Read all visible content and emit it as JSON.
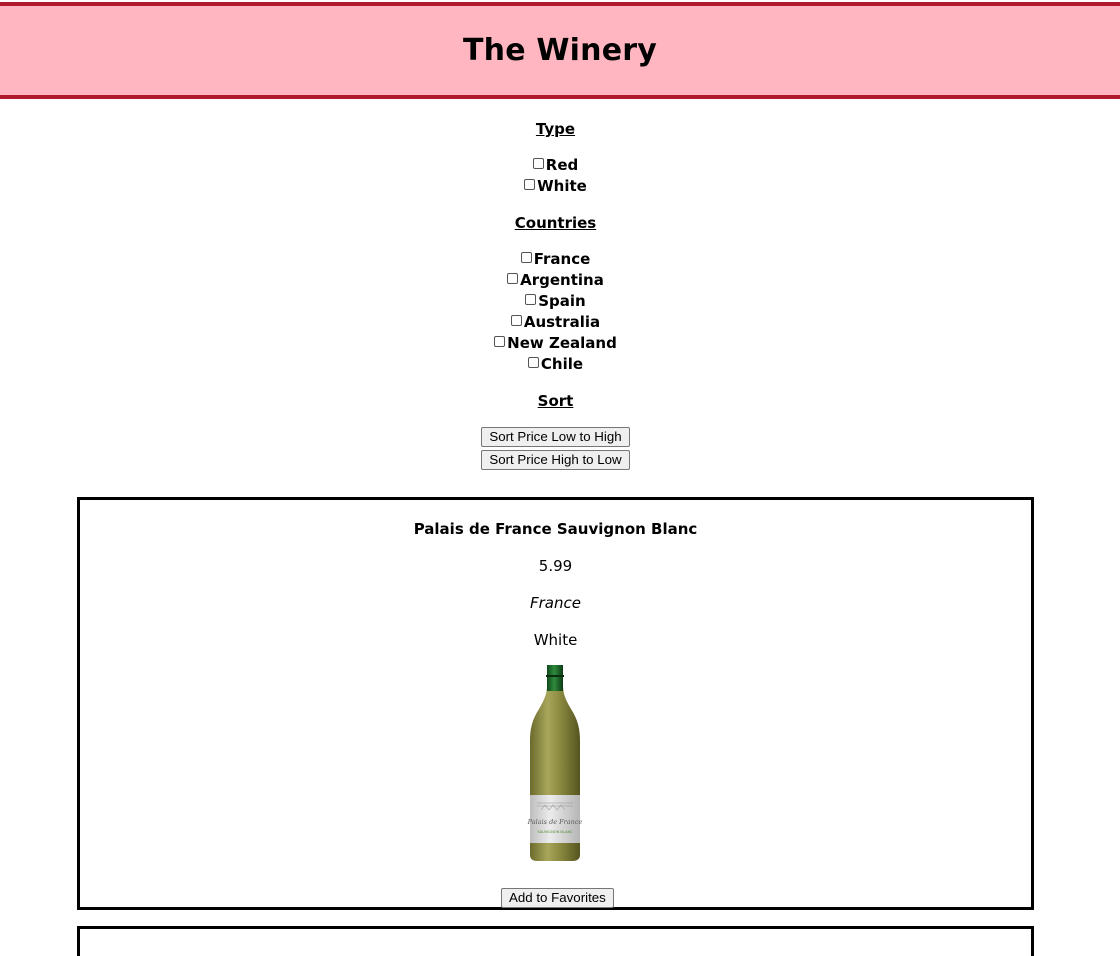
{
  "header": {
    "title": "The Winery"
  },
  "filters": {
    "type_title": "Type",
    "types": [
      "Red",
      "White"
    ],
    "countries_title": "Countries",
    "countries": [
      "France",
      "Argentina",
      "Spain",
      "Australia",
      "New Zealand",
      "Chile"
    ],
    "sort_title": "Sort",
    "sort_low_high": "Sort Price Low to High",
    "sort_high_low": "Sort Price High to Low"
  },
  "wines": [
    {
      "name": "Palais de France Sauvignon Blanc",
      "price": "5.99",
      "country": "France",
      "type": "White",
      "label_text": "Palais de France",
      "label_subtext": "SAUVIGNON BLANC",
      "favorite_label": "Add to Favorites"
    }
  ],
  "colors": {
    "header_bg": "#ffb6c1",
    "header_border": "#b01a2e"
  }
}
